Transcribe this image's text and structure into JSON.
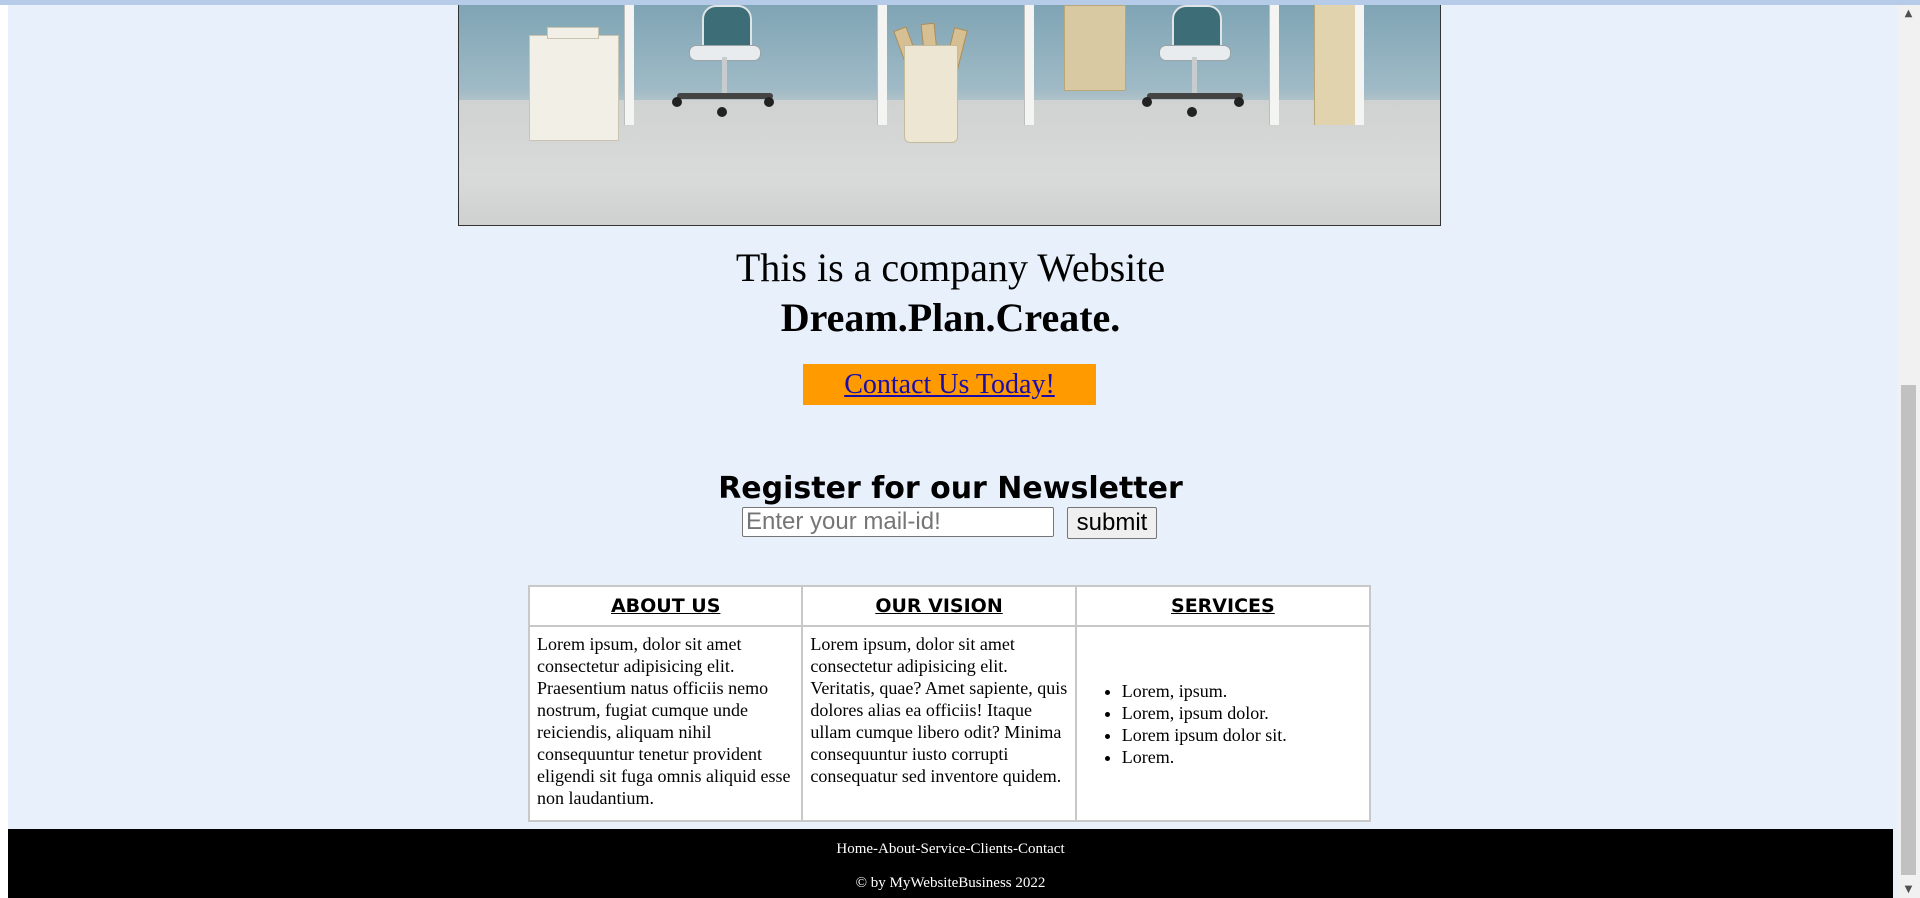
{
  "hero": {
    "image_alt": "office workspace with desks and chairs"
  },
  "main": {
    "tagline": "This is a company Website",
    "motto": "Dream.Plan.Create.",
    "cta_label": "Contact Us Today!"
  },
  "newsletter": {
    "title": "Register for our Newsletter",
    "email_placeholder": "Enter your mail-id!",
    "submit_label": "submit"
  },
  "info_table": {
    "headers": [
      "ABOUT US",
      "OUR VISION",
      "SERVICES"
    ],
    "about_text": "Lorem ipsum, dolor sit amet consectetur adipisicing elit. Praesentium natus officiis nemo nostrum, fugiat cumque unde reiciendis, aliquam nihil consequuntur tenetur provident eligendi sit fuga omnis aliquid esse non laudantium.",
    "vision_text": "Lorem ipsum, dolor sit amet consectetur adipisicing elit. Veritatis, quae? Amet sapiente, quis dolores alias ea officiis! Itaque ullam cumque libero odit? Minima consequuntur iusto corrupti consequatur sed inventore quidem.",
    "services": [
      "Lorem, ipsum.",
      "Lorem, ipsum dolor.",
      "Lorem ipsum dolor sit.",
      "Lorem."
    ]
  },
  "footer": {
    "nav": "Home-About-Service-Clients-Contact",
    "copyright": "© by MyWebsiteBusiness 2022"
  },
  "scrollbar": {
    "up_icon": "▲",
    "down_icon": "▼"
  },
  "colors": {
    "page_background": "#e8f0fb",
    "cta_background": "#ff9a00",
    "link": "#1a0dab",
    "footer_background": "#000000"
  }
}
